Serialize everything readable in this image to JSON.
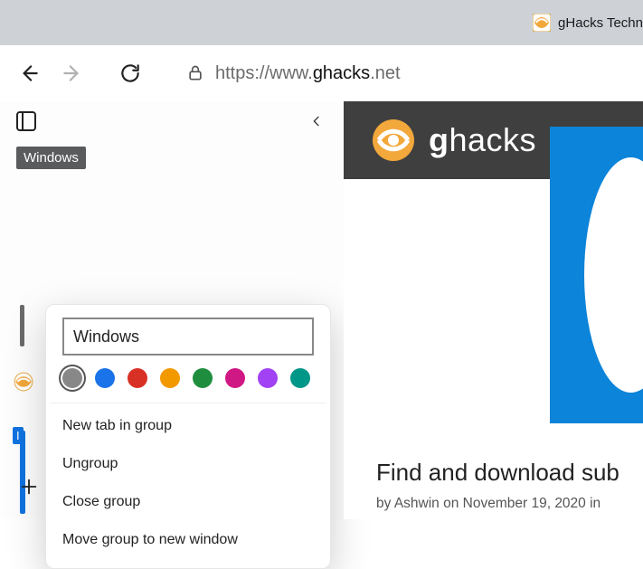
{
  "titlebar": {
    "title": "gHacks Techn"
  },
  "address": {
    "scheme": "https://www.",
    "host": "ghacks",
    "tld": ".net"
  },
  "sidebar": {
    "group_label": "Windows",
    "second_group_initial": "I"
  },
  "popup": {
    "name_value": "Windows",
    "colors": [
      "#888888",
      "#1a73e8",
      "#d93025",
      "#f29900",
      "#1e8e3e",
      "#d01884",
      "#a142f4",
      "#009688"
    ],
    "menu": {
      "new_tab": "New tab in group",
      "ungroup": "Ungroup",
      "close": "Close group",
      "move": "Move group to new window"
    }
  },
  "hero": {
    "brand_bold": "g",
    "brand_rest": "hacks"
  },
  "article": {
    "headline": "Find and download sub",
    "by_prefix": "by ",
    "author": "Ashwin",
    "on": " on ",
    "date": "November 19, 2020",
    "in": " in "
  }
}
